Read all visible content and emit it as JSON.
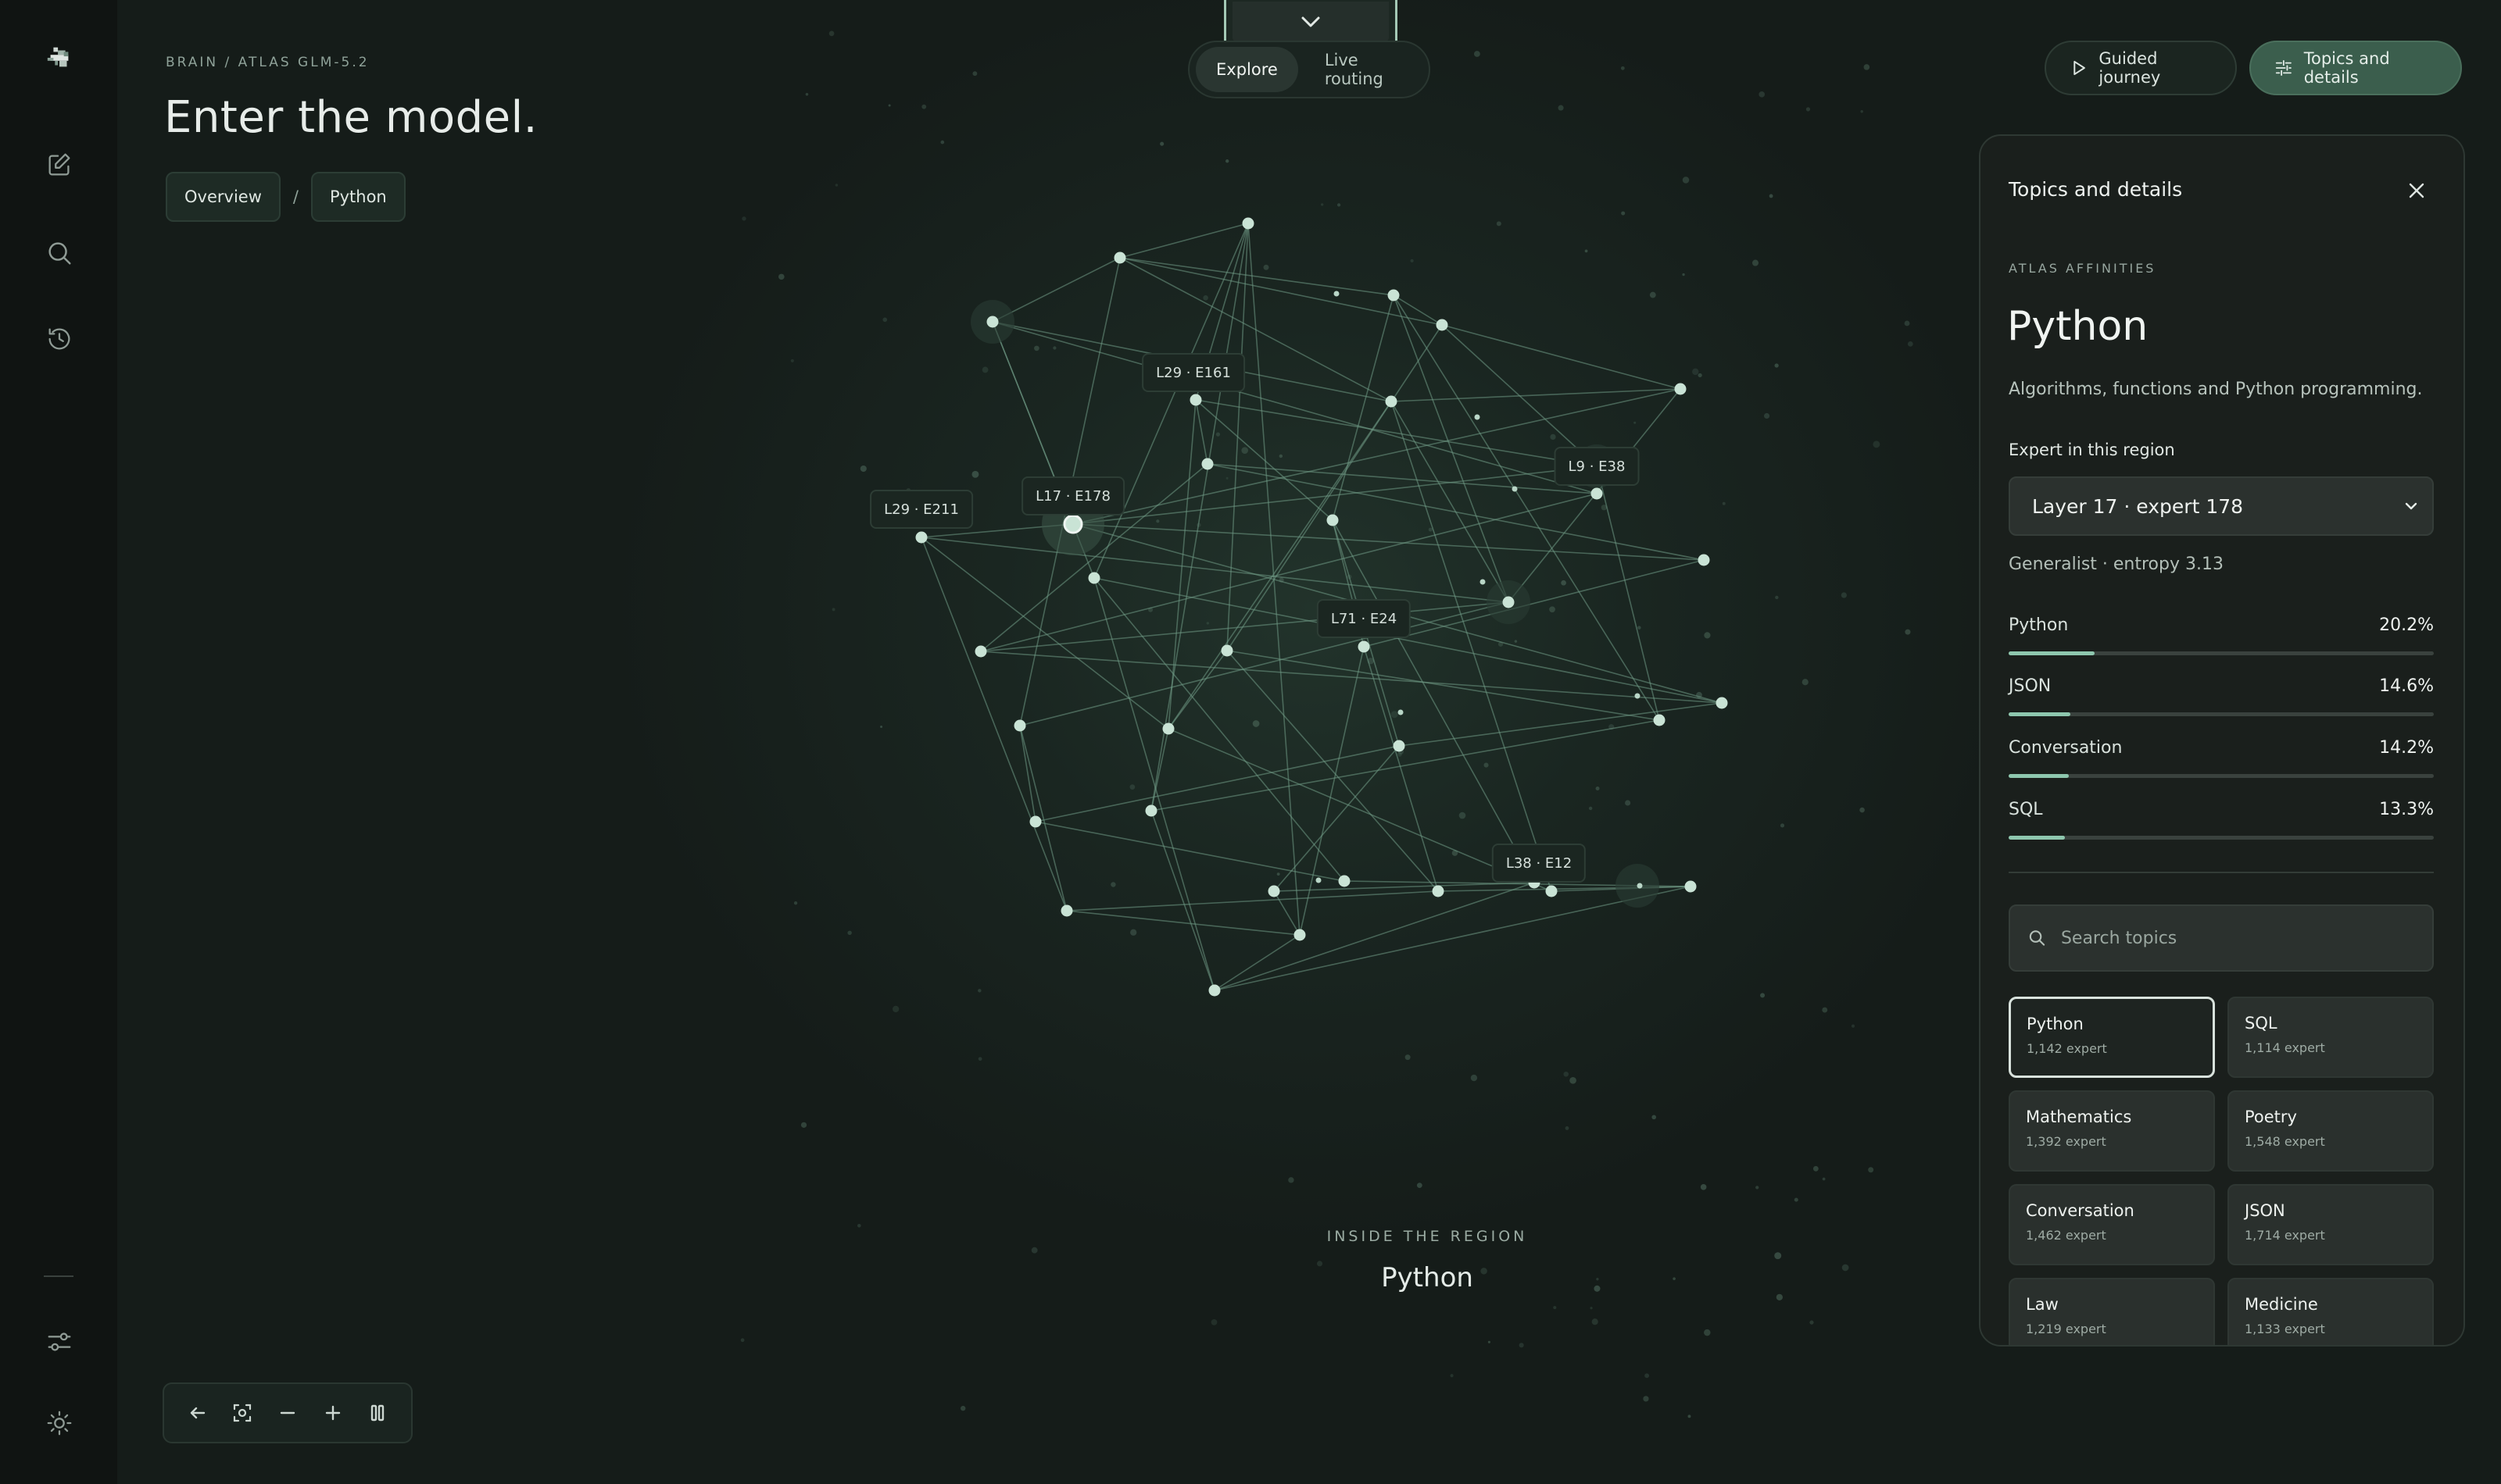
{
  "sidebar": {
    "items": [
      {
        "name": "logo-icon"
      },
      {
        "name": "new-note-icon"
      },
      {
        "name": "search-icon"
      },
      {
        "name": "history-icon"
      },
      {
        "name": "settings-sliders-icon"
      },
      {
        "name": "theme-sun-icon"
      }
    ]
  },
  "header": {
    "path": "BRAIN / ATLAS GLM-5.2",
    "title": "Enter the model.",
    "breadcrumbs": [
      "Overview",
      "Python"
    ],
    "separator": "/"
  },
  "mode_toggle": {
    "active": "Explore",
    "inactive": "Live routing"
  },
  "top_actions": {
    "guided": "Guided journey",
    "topics": "Topics and details"
  },
  "graph": {
    "labels": [
      "L29 · E161",
      "L9 · E38",
      "L17 · E178",
      "L29 · E211",
      "L71 · E24",
      "L38 · E12"
    ],
    "region_eyebrow": "INSIDE THE REGION",
    "region_name": "Python"
  },
  "panel": {
    "title": "Topics and details",
    "eyebrow": "ATLAS AFFINITIES",
    "topic": "Python",
    "description": "Algorithms, functions and Python programming.",
    "expert_label": "Expert in this region",
    "expert_selected": "Layer 17 · expert 178",
    "expert_meta": "Generalist · entropy 3.13",
    "affinities": [
      {
        "name": "Python",
        "value": "20.2%",
        "fraction": 0.202
      },
      {
        "name": "JSON",
        "value": "14.6%",
        "fraction": 0.146
      },
      {
        "name": "Conversation",
        "value": "14.2%",
        "fraction": 0.142
      },
      {
        "name": "SQL",
        "value": "13.3%",
        "fraction": 0.133
      }
    ],
    "search_placeholder": "Search topics",
    "topics": [
      {
        "name": "Python",
        "count": "1,142 expert",
        "selected": true
      },
      {
        "name": "SQL",
        "count": "1,114 expert"
      },
      {
        "name": "Mathematics",
        "count": "1,392 expert"
      },
      {
        "name": "Poetry",
        "count": "1,548 expert"
      },
      {
        "name": "Conversation",
        "count": "1,462 expert"
      },
      {
        "name": "JSON",
        "count": "1,714 expert"
      },
      {
        "name": "Law",
        "count": "1,219 expert"
      },
      {
        "name": "Medicine",
        "count": "1,133 expert"
      }
    ]
  },
  "colors": {
    "accent": "#8ec7ae",
    "node": "#c9e3d5",
    "edge": "#6f9a85",
    "active_button": "#3b5e4d"
  }
}
